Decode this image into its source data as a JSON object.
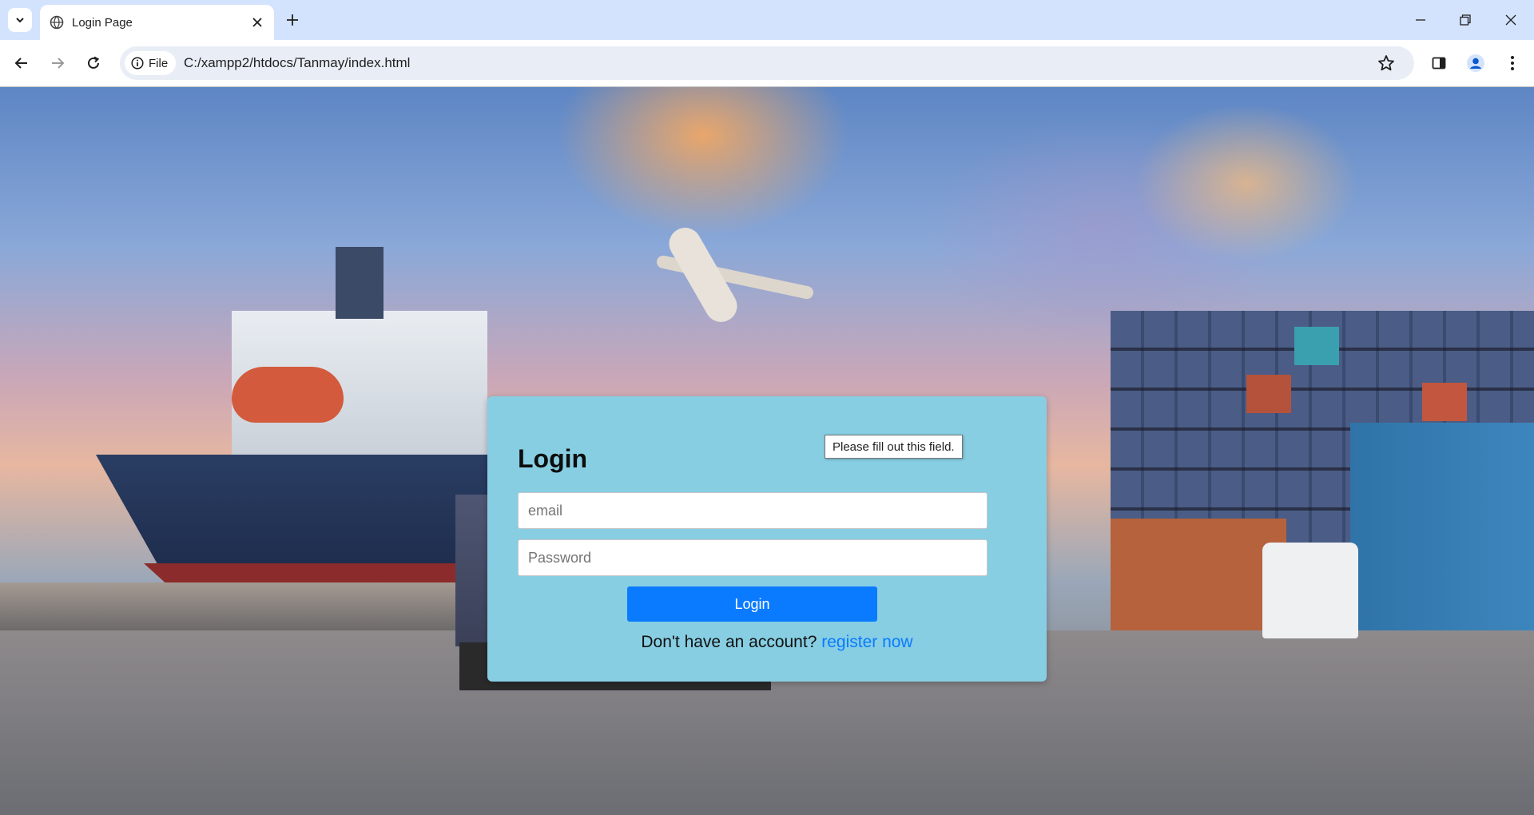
{
  "browser": {
    "tab_title": "Login Page",
    "file_chip_label": "File",
    "url": "C:/xampp2/htdocs/Tanmay/index.html"
  },
  "icons": {
    "tab_search": "chevron-down-icon",
    "tab_favicon": "globe-icon",
    "tab_close": "close-icon",
    "new_tab": "plus-icon",
    "minimize": "minimize-icon",
    "restore": "restore-icon",
    "window_close": "close-icon",
    "back": "arrow-left-icon",
    "forward": "arrow-right-icon",
    "reload": "reload-icon",
    "site_info": "info-icon",
    "bookmark": "star-icon",
    "side_panel": "side-panel-icon",
    "profile": "profile-icon",
    "menu": "kebab-menu-icon"
  },
  "login": {
    "heading": "Login",
    "email_placeholder": "email",
    "password_placeholder": "Password",
    "button_label": "Login",
    "register_prompt": "Don't have an account?",
    "register_link": "register now"
  },
  "tooltip": {
    "text": "Please fill out this field."
  },
  "colors": {
    "card_background": "#87cee3",
    "button_background": "#0a7bff",
    "link": "#0a7bff",
    "tabbar": "#d3e3fd"
  }
}
